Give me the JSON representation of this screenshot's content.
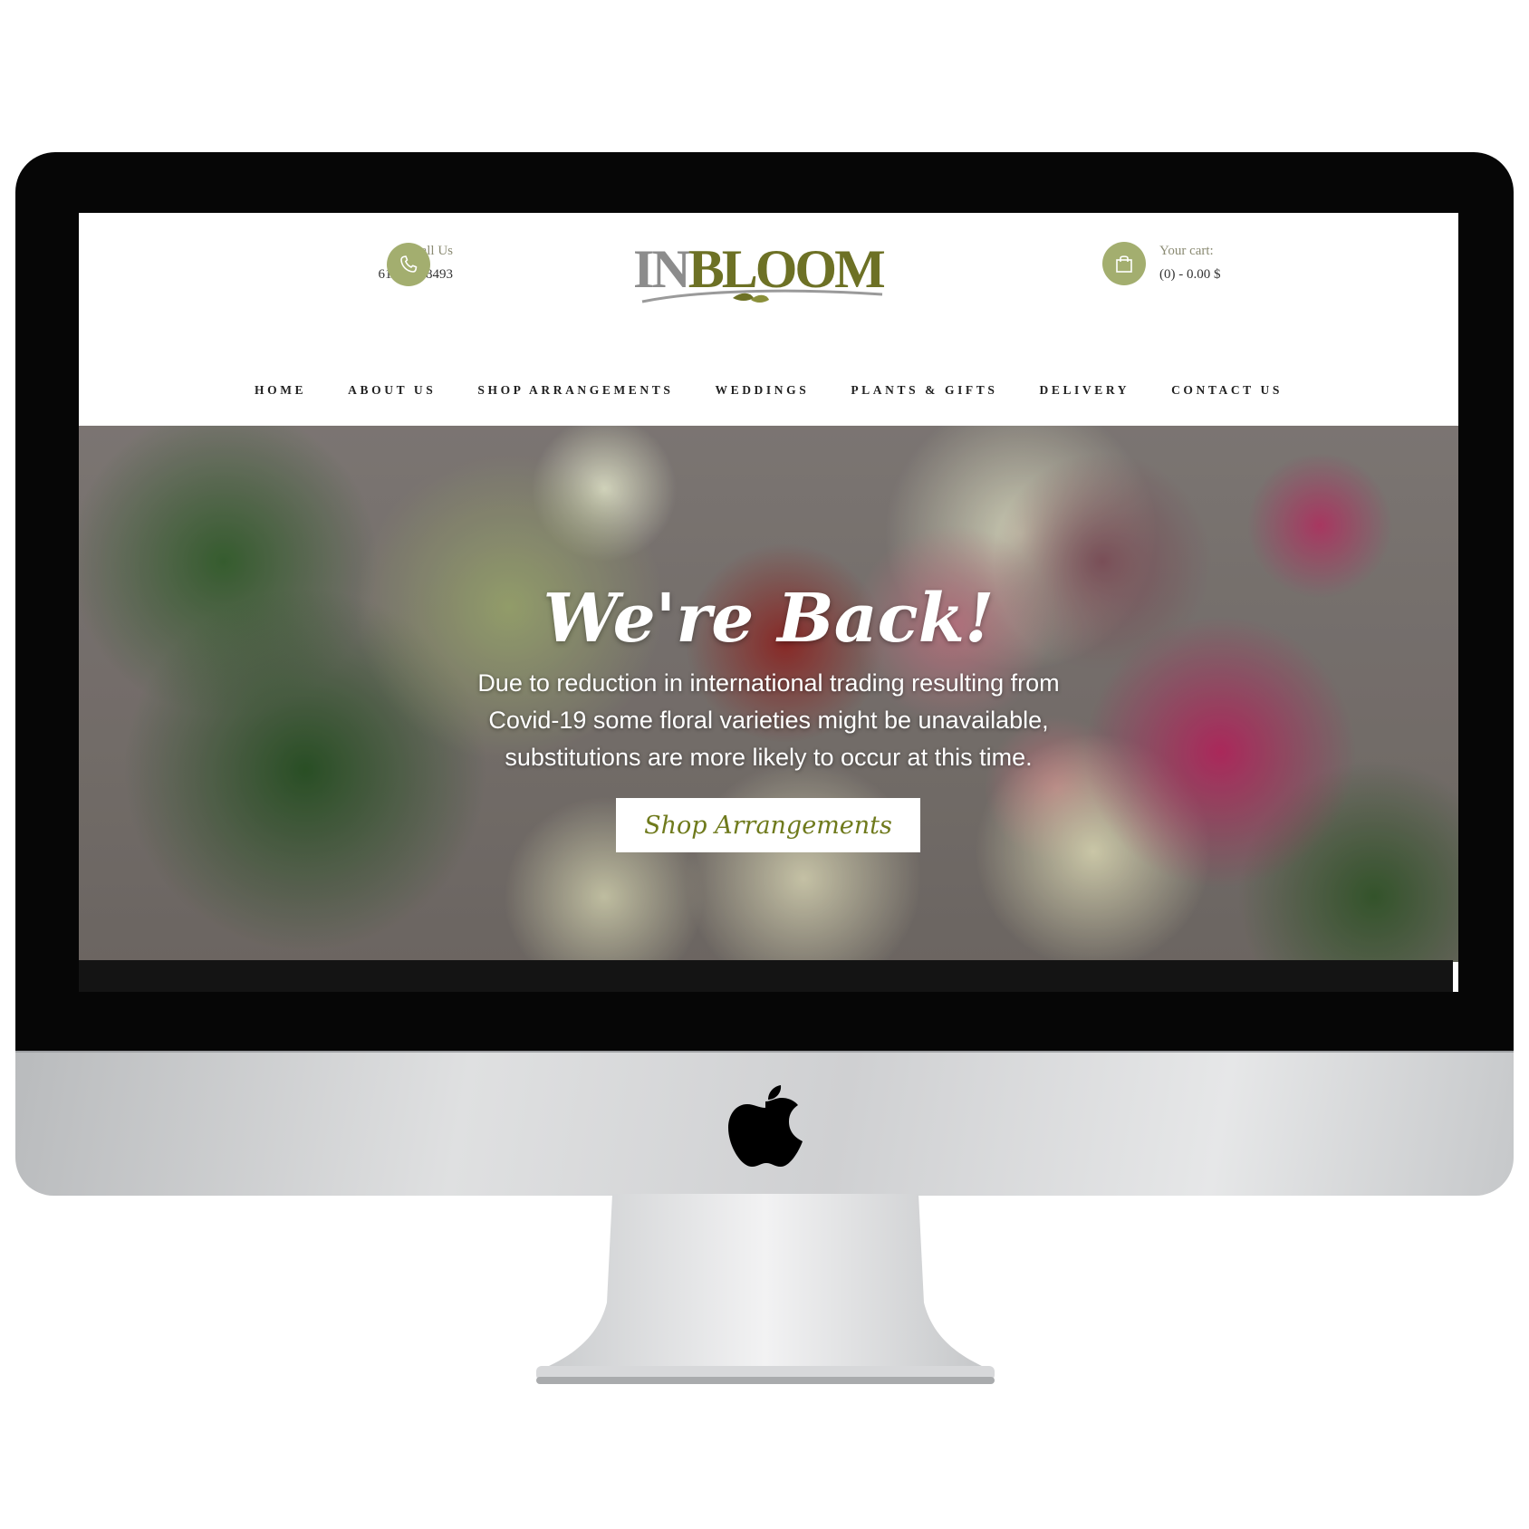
{
  "header": {
    "call_label": "Call Us",
    "call_number": "613 831 8493",
    "logo": {
      "in": "IN",
      "bloom": "BLOOM",
      "alt": "InBloom"
    },
    "cart_label": "Your cart:",
    "cart_summary": "(0) - 0.00 $"
  },
  "nav": {
    "items": [
      {
        "label": "HOME"
      },
      {
        "label": "ABOUT US"
      },
      {
        "label": "SHOP ARRANGEMENTS"
      },
      {
        "label": "WEDDINGS"
      },
      {
        "label": "PLANTS & GIFTS"
      },
      {
        "label": "DELIVERY"
      },
      {
        "label": "CONTACT US"
      }
    ]
  },
  "hero": {
    "title": "We're Back!",
    "text": "Due to reduction in international trading resulting from Covid-19 some floral varieties might be unavailable, substitutions are more likely to occur at this time.",
    "button_label": "Shop Arrangements"
  },
  "colors": {
    "accent": "#a3ae6f",
    "logo_green": "#6d7125",
    "button_text": "#6f7a1c"
  },
  "icons": {
    "phone": "phone-icon",
    "cart": "shopping-bag-icon",
    "device": "apple-logo-icon"
  }
}
